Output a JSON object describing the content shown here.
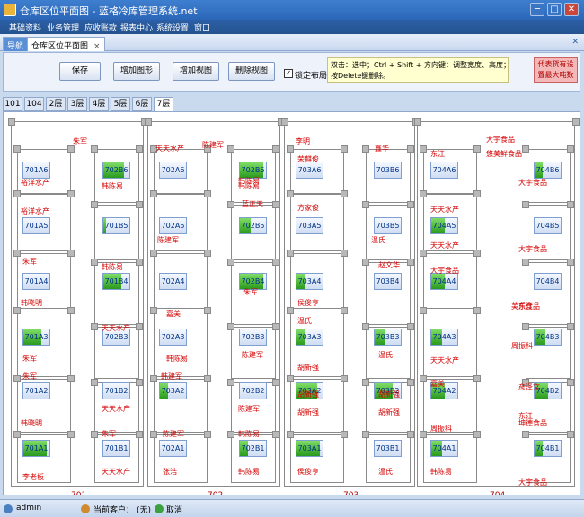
{
  "window": {
    "title": "仓库区位平面图 - 蓝格冷库管理系统.net",
    "min": "─",
    "max": "□",
    "close": "✕"
  },
  "menu": [
    "基础资料",
    "业务管理",
    "应收账款",
    "报表中心",
    "系统设置",
    "窗口"
  ],
  "doc_tabs": {
    "nav": "导航",
    "active": "仓库区位平面图",
    "close": "×",
    "pin": "✕"
  },
  "toolbar": {
    "save": "保存",
    "add_shape": "增加图形",
    "add_view": "增加视图",
    "delete_view": "删除视图",
    "lock_layout": "锁定布局",
    "lock_checked": "✓",
    "hint_line1": "双击：选中；Ctrl + Shift + 方向键：调整宽度、高度；",
    "hint_line2": "按Delete键删除。",
    "legend_line1": "代表货有设",
    "legend_line2": "置最大吨数"
  },
  "floor_tabs": [
    "101",
    "104",
    "2层",
    "3层",
    "4层",
    "5层",
    "6层",
    "7层"
  ],
  "active_floor_index": 7,
  "areas": [
    {
      "name": "701",
      "owners": [
        {
          "text": "朱军"
        },
        {
          "text": "裕洋水产"
        },
        {
          "text": "韩陈易"
        },
        {
          "text": "裕洋水产"
        },
        {
          "text": "朱军"
        },
        {
          "text": "韩陈易"
        },
        {
          "text": "韩晓明"
        },
        {
          "text": "天天水产"
        },
        {
          "text": "朱军"
        },
        {
          "text": "朱军"
        },
        {
          "text": "天天水产"
        },
        {
          "text": "韩晓明"
        },
        {
          "text": "朱军"
        },
        {
          "text": "天天水产"
        },
        {
          "text": "李老板"
        }
      ],
      "slots": [
        {
          "code": "701A6",
          "fill": 0
        },
        {
          "code": "702B6",
          "fill": 0.8
        },
        {
          "code": "701A5",
          "fill": 0
        },
        {
          "code": "701B5",
          "fill": 0.1
        },
        {
          "code": "701A4",
          "fill": 0
        },
        {
          "code": "701B4",
          "fill": 0.7
        },
        {
          "code": "701A3",
          "fill": 0.7
        },
        {
          "code": "702B3",
          "fill": 0
        },
        {
          "code": "701A2",
          "fill": 0
        },
        {
          "code": "701B2",
          "fill": 0
        },
        {
          "code": "701A1",
          "fill": 0.9
        },
        {
          "code": "701B1",
          "fill": 0
        }
      ]
    },
    {
      "name": "702",
      "owners": [
        {
          "text": "天天水产"
        },
        {
          "text": "陈建军"
        },
        {
          "text": "韩陈易"
        },
        {
          "text": "韩陈易"
        },
        {
          "text": "陈建军"
        },
        {
          "text": "蓝正天"
        },
        {
          "text": "朱军"
        },
        {
          "text": "嘉美"
        },
        {
          "text": "陈建军"
        },
        {
          "text": "韩陈易"
        },
        {
          "text": "韩建军"
        },
        {
          "text": "陈建军"
        },
        {
          "text": "陈建军"
        },
        {
          "text": "韩陈易"
        },
        {
          "text": "张浩"
        },
        {
          "text": "韩陈易"
        }
      ],
      "slots": [
        {
          "code": "702A6",
          "fill": 0
        },
        {
          "code": "702B6",
          "fill": 0.9
        },
        {
          "code": "702A5",
          "fill": 0
        },
        {
          "code": "702B5",
          "fill": 0.4
        },
        {
          "code": "702A4",
          "fill": 0
        },
        {
          "code": "702B4",
          "fill": 0.9
        },
        {
          "code": "702A3",
          "fill": 0
        },
        {
          "code": "702B3",
          "fill": 0
        },
        {
          "code": "703A2",
          "fill": 0.3
        },
        {
          "code": "702B2",
          "fill": 0
        },
        {
          "code": "702A1",
          "fill": 0
        },
        {
          "code": "702B1",
          "fill": 0.3
        }
      ]
    },
    {
      "name": "703",
      "owners": [
        {
          "text": "李明"
        },
        {
          "text": "鑫华"
        },
        {
          "text": "荣麒俊"
        },
        {
          "text": "方家俊"
        },
        {
          "text": "温氏"
        },
        {
          "text": "赵文华"
        },
        {
          "text": "侯俊亨"
        },
        {
          "text": "温氏"
        },
        {
          "text": "温氏"
        },
        {
          "text": "胡新强"
        },
        {
          "text": "胡新强"
        },
        {
          "text": "胡新强"
        },
        {
          "text": "胡新强"
        },
        {
          "text": "胡新强"
        },
        {
          "text": "侯俊亨"
        },
        {
          "text": "温氏"
        }
      ],
      "slots": [
        {
          "code": "703A6",
          "fill": 0
        },
        {
          "code": "703B6",
          "fill": 0
        },
        {
          "code": "703A5",
          "fill": 0
        },
        {
          "code": "703B5",
          "fill": 0
        },
        {
          "code": "703A4",
          "fill": 0.3
        },
        {
          "code": "703B4",
          "fill": 0
        },
        {
          "code": "703A3",
          "fill": 0.3
        },
        {
          "code": "703B3",
          "fill": 0.4
        },
        {
          "code": "703A2",
          "fill": 0.8
        },
        {
          "code": "703B2",
          "fill": 0.7
        },
        {
          "code": "703A1",
          "fill": 0.9
        },
        {
          "code": "703B1",
          "fill": 0
        }
      ]
    },
    {
      "name": "704",
      "owners": [
        {
          "text": "大宇食品"
        },
        {
          "text": "东江"
        },
        {
          "text": "悠美鲜食品"
        },
        {
          "text": "大宇食品"
        },
        {
          "text": "天天水产"
        },
        {
          "text": "天天水产"
        },
        {
          "text": "大宇食品"
        },
        {
          "text": "大宇食品"
        },
        {
          "text": "东江"
        },
        {
          "text": "美乐食品"
        },
        {
          "text": "天天水产"
        },
        {
          "text": "周振科"
        },
        {
          "text": "嘉美"
        },
        {
          "text": "彦泽文"
        },
        {
          "text": "周振科"
        },
        {
          "text": "东江"
        },
        {
          "text": "坤德食品"
        },
        {
          "text": "韩陈易"
        },
        {
          "text": "大宇食品"
        }
      ],
      "slots": [
        {
          "code": "704A6",
          "fill": 0
        },
        {
          "code": "704B6",
          "fill": 0.3
        },
        {
          "code": "704A5",
          "fill": 0.5
        },
        {
          "code": "704B5",
          "fill": 0
        },
        {
          "code": "704A4",
          "fill": 0.5
        },
        {
          "code": "704B4",
          "fill": 0
        },
        {
          "code": "704A3",
          "fill": 0.4
        },
        {
          "code": "704B3",
          "fill": 0.4
        },
        {
          "code": "704A2",
          "fill": 0.5
        },
        {
          "code": "704B2",
          "fill": 0.5
        },
        {
          "code": "704A1",
          "fill": 0.4
        },
        {
          "code": "704B1",
          "fill": 0.3
        }
      ]
    }
  ],
  "status": {
    "user": "admin",
    "customer_label": "当前客户：",
    "customer_value": "(无)",
    "cancel": "取消"
  }
}
